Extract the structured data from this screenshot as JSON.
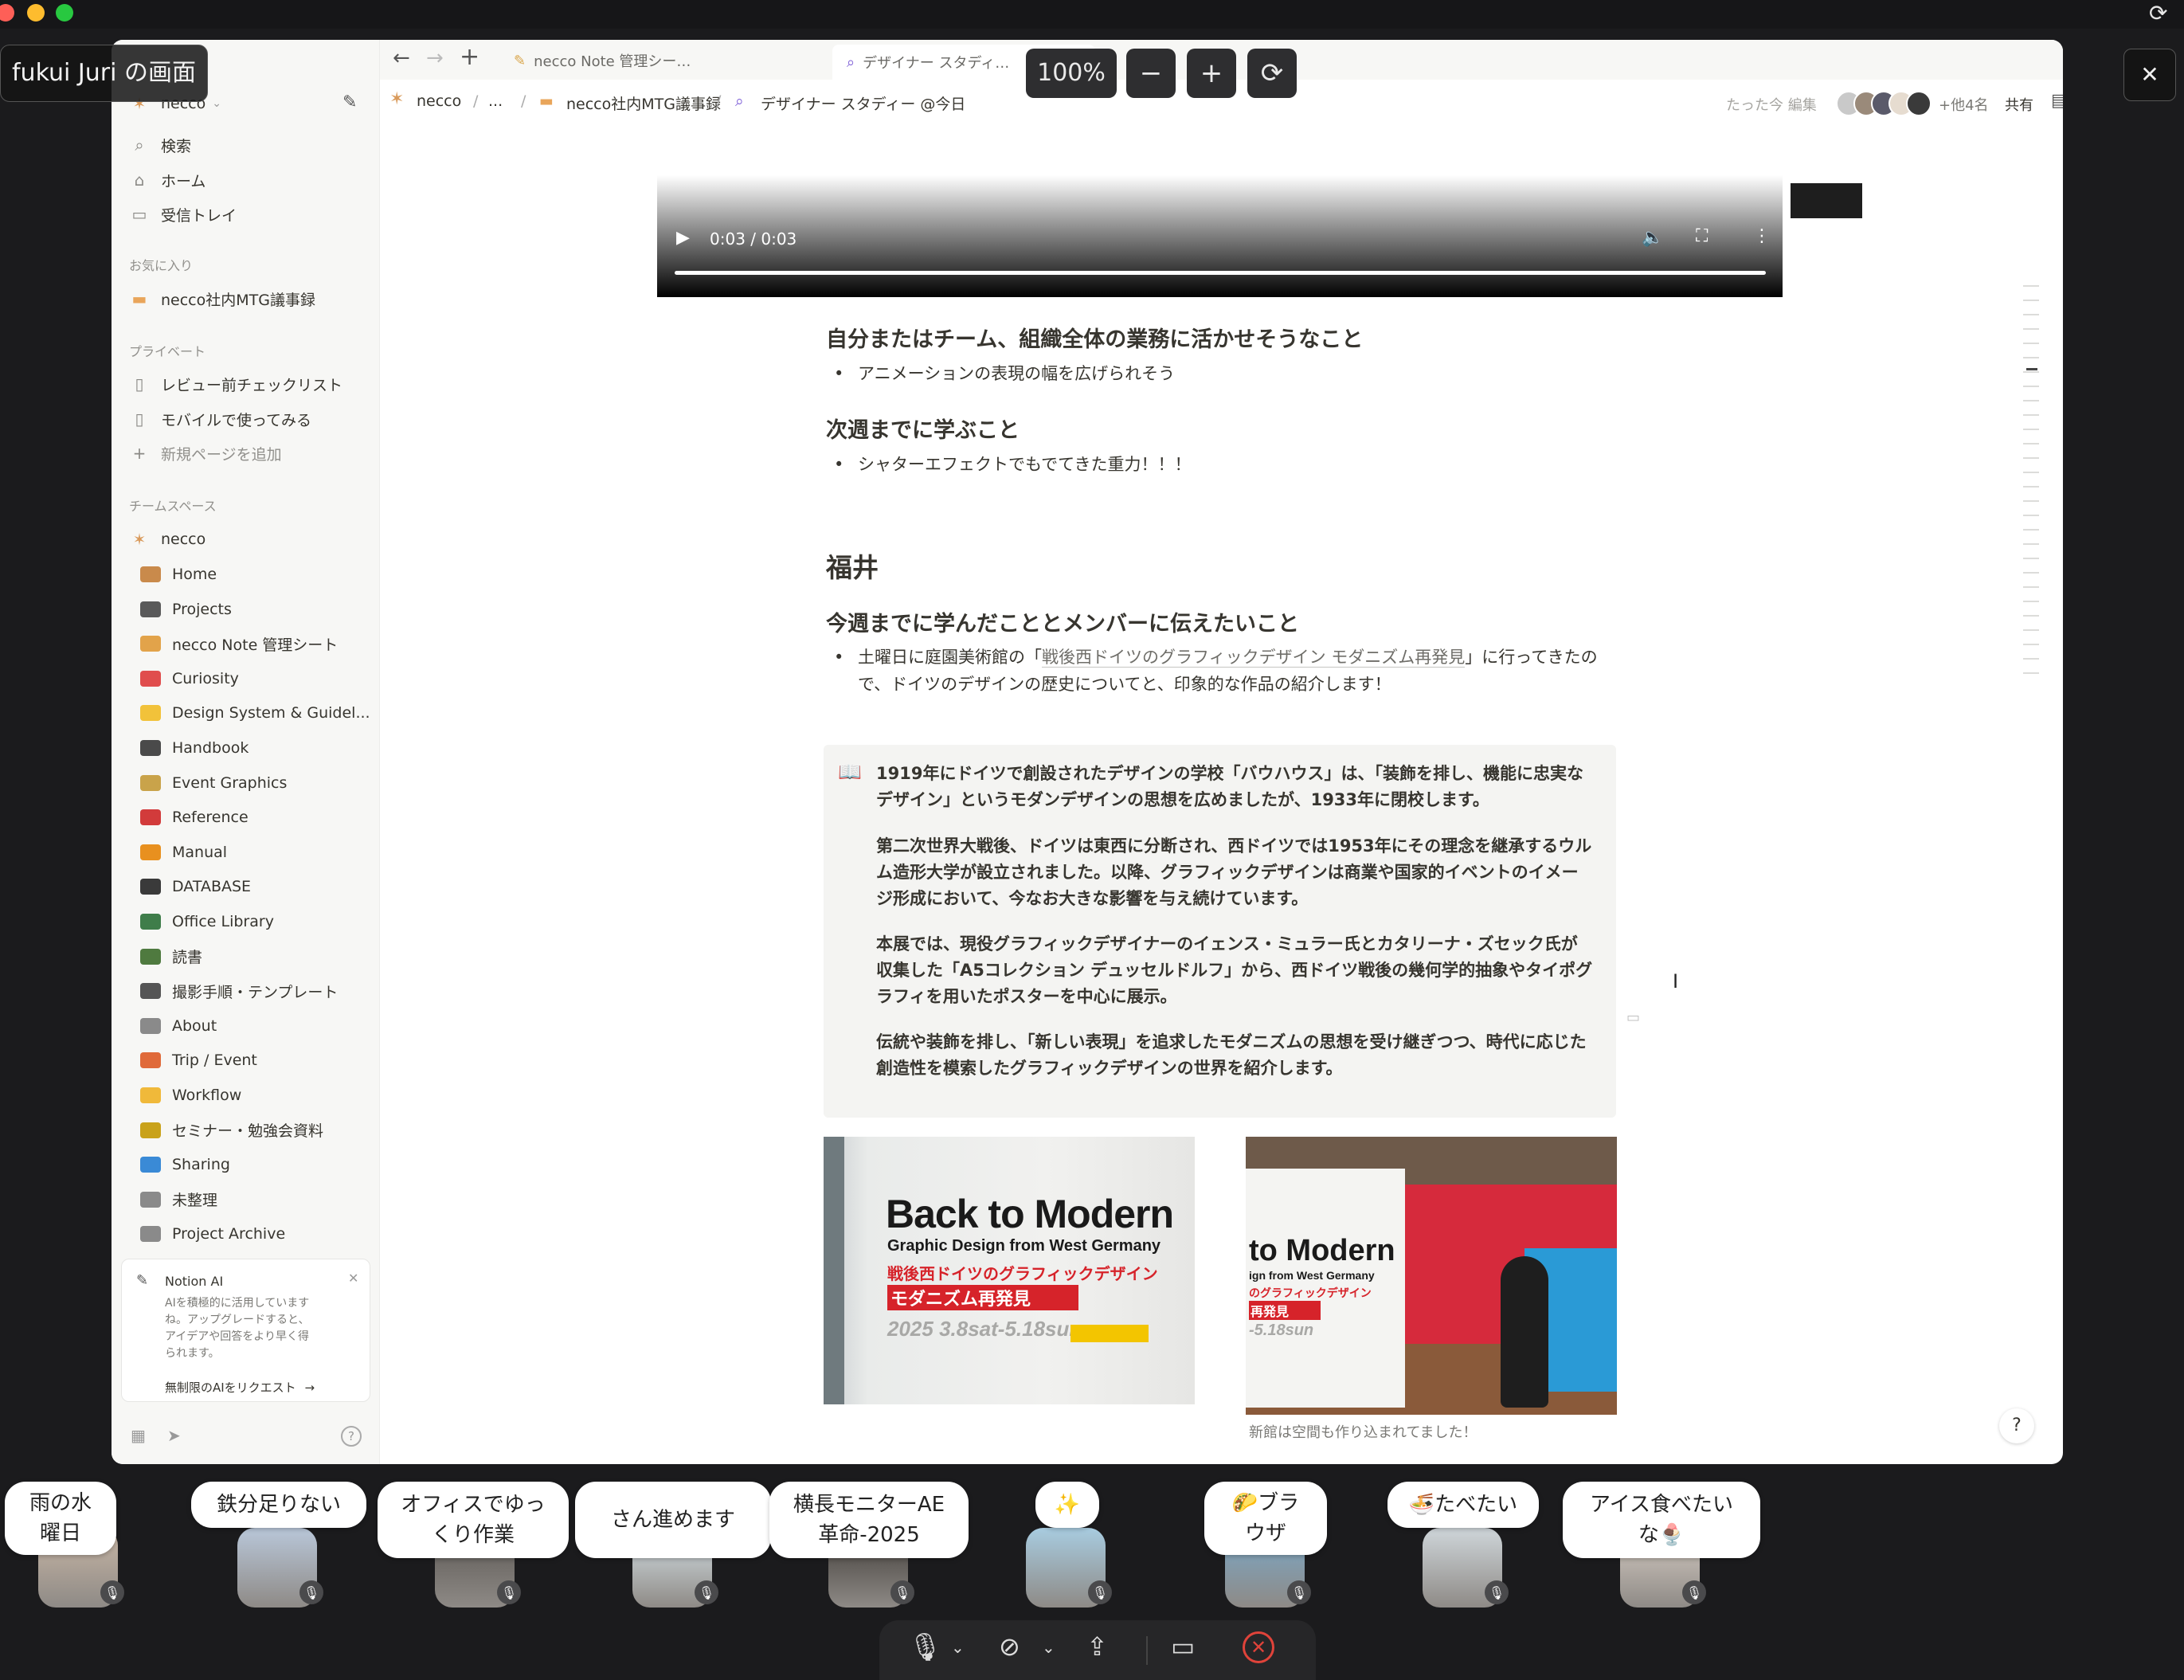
{
  "screen_share": {
    "label": "fukui Juri の画面",
    "zoom": "100%",
    "zoom_out": "−",
    "zoom_in": "+",
    "reset": "⟳",
    "close": "✕"
  },
  "tabs": [
    {
      "label": "necco Note 管理シー…"
    },
    {
      "label": "デザイナー スタディ…"
    }
  ],
  "nav": {
    "back": "←",
    "forward": "→",
    "new_tab": "+"
  },
  "breadcrumb": {
    "root": "necco",
    "sep": "/",
    "ellipsis": "...",
    "parent": "necco社内MTG議事録",
    "current": "デザイナー スタディー @今日"
  },
  "topbar": {
    "edited": "たった今 編集",
    "others": "+他4名",
    "share": "共有"
  },
  "sidebar": {
    "workspace": "necco",
    "top_items": [
      {
        "label": "検索",
        "icon": "search-icon"
      },
      {
        "label": "ホーム",
        "icon": "home-icon"
      },
      {
        "label": "受信トレイ",
        "icon": "inbox-icon"
      }
    ],
    "favorites_header": "お気に入り",
    "favorites": [
      {
        "label": "necco社内MTG議事録"
      }
    ],
    "private_header": "プライベート",
    "private": [
      {
        "label": "レビュー前チェックリスト"
      },
      {
        "label": "モバイルで使ってみる"
      },
      {
        "label": "新規ページを追加"
      }
    ],
    "team_header": "チームスペース",
    "team_root": "necco",
    "team": [
      {
        "label": "Home",
        "color": "#c98a4b"
      },
      {
        "label": "Projects",
        "color": "#5a5a5a"
      },
      {
        "label": "necco Note 管理シート",
        "color": "#e2a34a"
      },
      {
        "label": "Curiosity",
        "color": "#e04d4d"
      },
      {
        "label": "Design System & Guidel...",
        "color": "#f2c23a"
      },
      {
        "label": "Handbook",
        "color": "#4a4a4a"
      },
      {
        "label": "Event Graphics",
        "color": "#c9a34a"
      },
      {
        "label": "Reference",
        "color": "#d23b3b"
      },
      {
        "label": "Manual",
        "color": "#e8901f"
      },
      {
        "label": "DATABASE",
        "color": "#3a3a3a"
      },
      {
        "label": "Office Library",
        "color": "#3f7d4a"
      },
      {
        "label": "読書",
        "color": "#4f7a3f"
      },
      {
        "label": "撮影手順・テンプレート",
        "color": "#555555"
      },
      {
        "label": "About",
        "color": "#8a8a8a"
      },
      {
        "label": "Trip / Event",
        "color": "#e06a3a"
      },
      {
        "label": "Workflow",
        "color": "#f0b93a"
      },
      {
        "label": "セミナー・勉強会資料",
        "color": "#c9a21a"
      },
      {
        "label": "Sharing",
        "color": "#3a8ad6"
      },
      {
        "label": "未整理",
        "color": "#8a8a8a"
      },
      {
        "label": "Project Archive",
        "color": "#8a8a8a"
      }
    ],
    "ai_card": {
      "title": "Notion AI",
      "body": "AIを積極的に活用していますね。アップグレードすると、アイデアや回答をより早く得られます。",
      "cta": "無制限のAIをリクエスト"
    }
  },
  "video": {
    "time": "0:03 / 0:03"
  },
  "content": {
    "h_apply": "自分またはチーム、組織全体の業務に活かせそうなこと",
    "b_apply": "アニメーションの表現の幅を広げられそう",
    "h_next": "次週までに学ぶこと",
    "b_next": "シャターエフェクトでもでてきた重力！！！",
    "h_name": "福井",
    "h_learned": "今週までに学んだこととメンバーに伝えたいこと",
    "b_learned_pre": "土曜日に庭園美術館の「",
    "b_learned_link": "戦後西ドイツのグラフィックデザイン モダニズム再発見",
    "b_learned_post": "」に行ってきたので、ドイツのデザインの歴史についてと、印象的な作品の紹介します！",
    "callout_icon": "📖",
    "callout": [
      "1919年にドイツで創設されたデザインの学校「バウハウス」は、「装飾を排し、機能に忠実なデザイン」というモダンデザインの思想を広めましたが、1933年に閉校します。",
      "第二次世界大戦後、ドイツは東西に分断され、西ドイツでは1953年にその理念を継承するウルム造形大学が設立されました。以降、グラフィックデザインは商業や国家的イベントのイメージ形成において、今なお大きな影響を与え続けています。",
      "本展では、現役グラフィックデザイナーのイェンス・ミュラー氏とカタリーナ・ズセック氏が収集した「A5コレクション デュッセルドルフ」から、西ドイツ戦後の幾何学的抽象やタイポグラフィを用いたポスターを中心に展示。",
      "伝統や装飾を排し、「新しい表現」を追求したモダニズムの思想を受け継ぎつつ、時代に応じた創造性を模索したグラフィックデザインの世界を紹介します。"
    ],
    "img1": {
      "line1": "Back to Modern",
      "line2": "Graphic Design from West Germany",
      "line3": "戦後西ドイツのグラフィックデザイン",
      "line4": "モダニズム再発見",
      "line5": "2025 3.8sat-5.18sun"
    },
    "img2": {
      "line1": "to Modern",
      "line2": "ign from West Germany",
      "line3": "のグラフィックデザイン",
      "line4": "再発見",
      "line5": "-5.18sun"
    },
    "caption2": "新館は空間も作り込まれてました！",
    "help": "?"
  },
  "participants": [
    {
      "status": "雨の水曜日"
    },
    {
      "status": "鉄分足りない"
    },
    {
      "status": "オフィスでゆっくり作業"
    },
    {
      "status": "さん進めます"
    },
    {
      "status": "横長モニターAE革命-2025"
    },
    {
      "status": "✨"
    },
    {
      "status": "🌮ブラウザ"
    },
    {
      "status": "🍜たべたい"
    },
    {
      "status": "アイス食べたいな🍨"
    }
  ],
  "controls": {
    "mic": "mic-muted-icon",
    "camera": "camera-off-icon",
    "share": "share-screen-icon",
    "chat": "chat-icon",
    "leave": "leave-icon"
  }
}
